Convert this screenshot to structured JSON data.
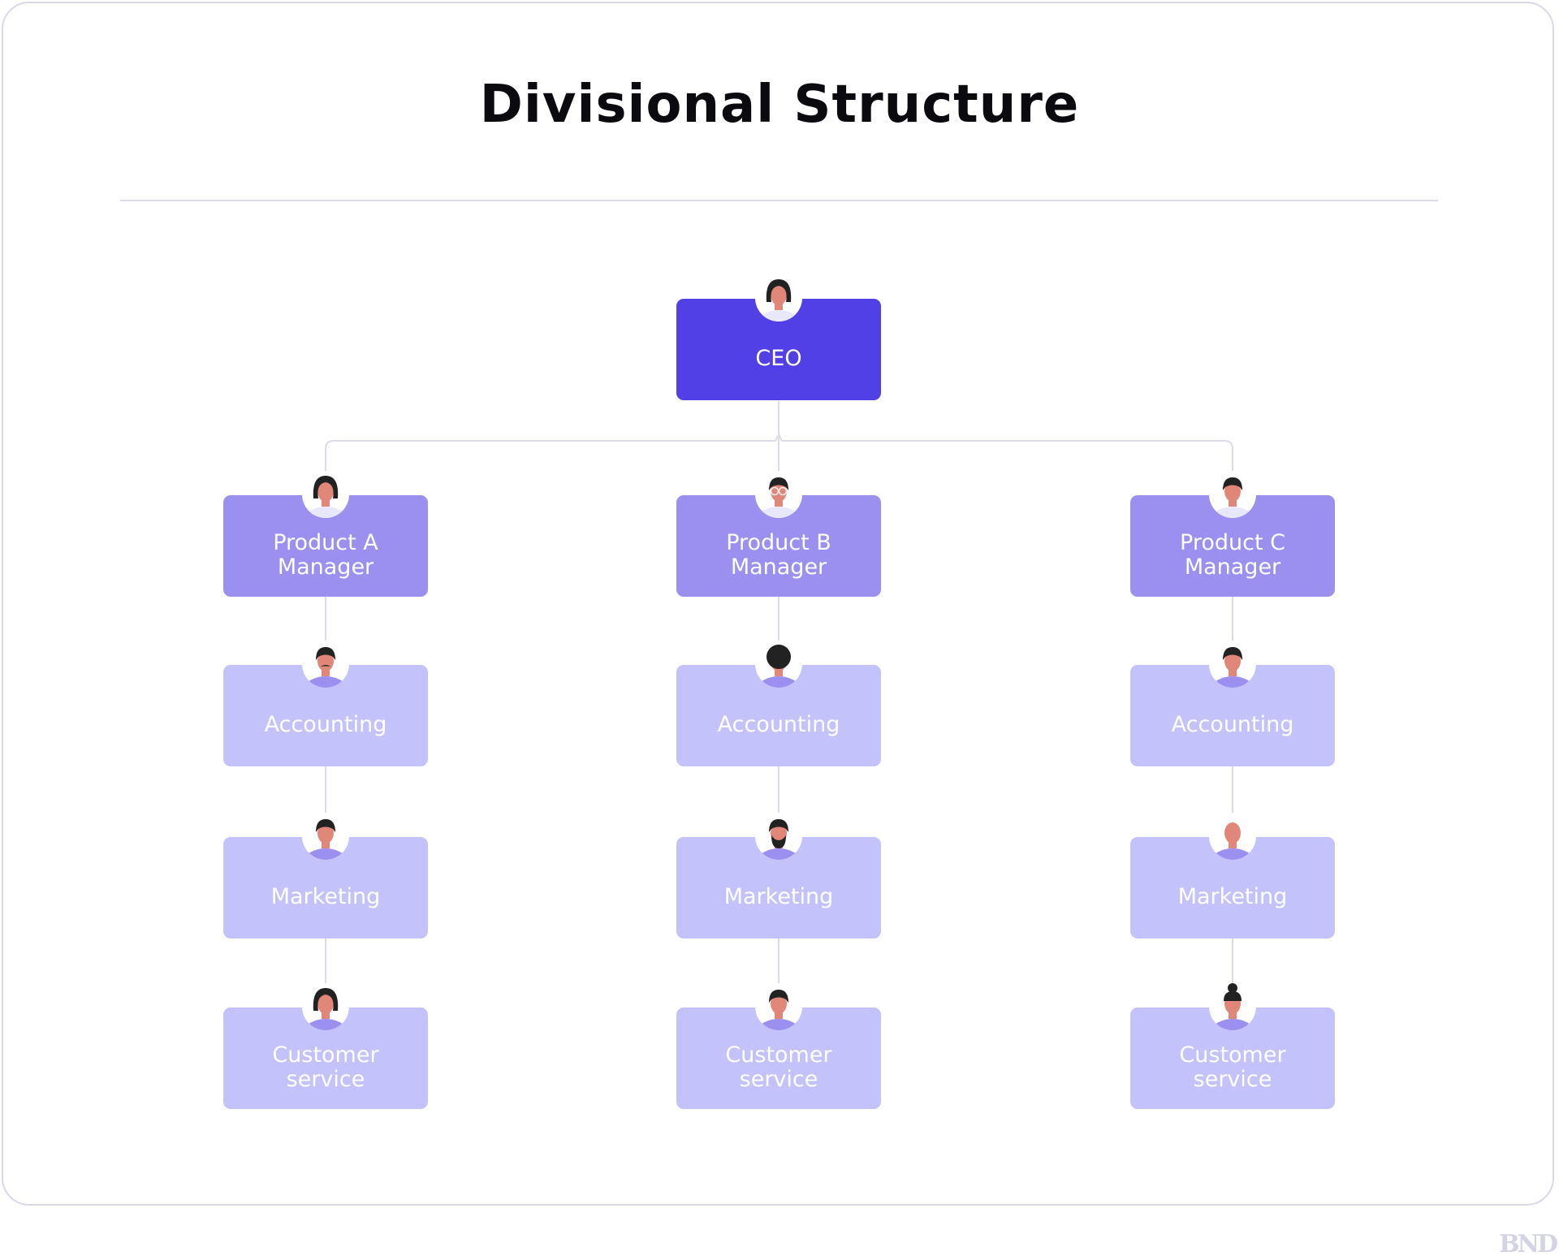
{
  "title": "Divisional Structure",
  "watermark": "BND",
  "colors": {
    "ceo": "#5140e6",
    "manager": "#9b8ff0",
    "department": "#c4c2fb",
    "connector": "#dcdbe7",
    "skin": "#e0877a",
    "hair": "#222222"
  },
  "ceo": {
    "label": "CEO",
    "avatar": "woman-avatar-icon"
  },
  "divisions": [
    {
      "manager": {
        "label_line1": "Product A",
        "label_line2": "Manager",
        "avatar": "woman-curly-hair-avatar-icon"
      },
      "departments": [
        {
          "label_line1": "Accounting",
          "label_line2": "",
          "avatar": "man-mustache-avatar-icon"
        },
        {
          "label_line1": "Marketing",
          "label_line2": "",
          "avatar": "man-avatar-icon"
        },
        {
          "label_line1": "Customer",
          "label_line2": "service",
          "avatar": "woman-avatar-icon"
        }
      ]
    },
    {
      "manager": {
        "label_line1": "Product B",
        "label_line2": "Manager",
        "avatar": "man-glasses-avatar-icon"
      },
      "departments": [
        {
          "label_line1": "Accounting",
          "label_line2": "",
          "avatar": "afro-avatar-icon"
        },
        {
          "label_line1": "Marketing",
          "label_line2": "",
          "avatar": "man-beard-avatar-icon"
        },
        {
          "label_line1": "Customer",
          "label_line2": "service",
          "avatar": "man-avatar-icon"
        }
      ]
    },
    {
      "manager": {
        "label_line1": "Product C",
        "label_line2": "Manager",
        "avatar": "man-avatar-icon"
      },
      "departments": [
        {
          "label_line1": "Accounting",
          "label_line2": "",
          "avatar": "man-avatar-icon"
        },
        {
          "label_line1": "Marketing",
          "label_line2": "",
          "avatar": "bald-man-avatar-icon"
        },
        {
          "label_line1": "Customer",
          "label_line2": "service",
          "avatar": "woman-bun-avatar-icon"
        }
      ]
    }
  ]
}
